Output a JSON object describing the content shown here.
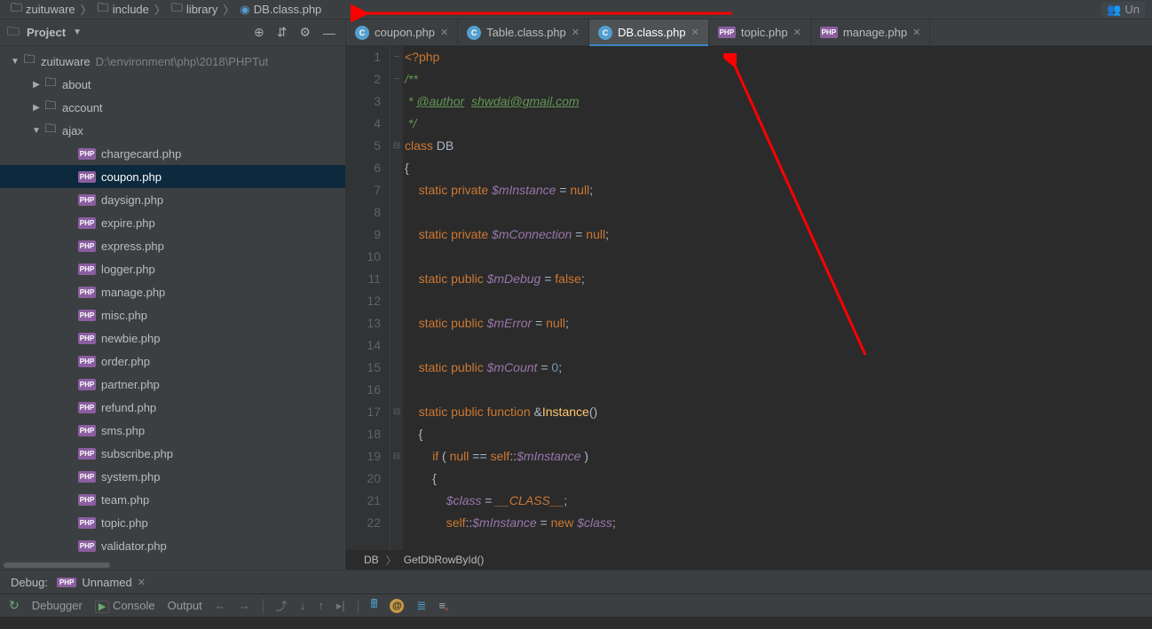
{
  "breadcrumbs": [
    {
      "icon": "folder",
      "label": "zuituware"
    },
    {
      "icon": "folder",
      "label": "include"
    },
    {
      "icon": "folder",
      "label": "library"
    },
    {
      "icon": "php-round",
      "label": "DB.class.php"
    }
  ],
  "top_right_badge": {
    "icon": "mask",
    "label": "Un"
  },
  "project_panel": {
    "title": "Project",
    "tools": [
      "target",
      "collapse",
      "gear",
      "minimize"
    ],
    "tree": [
      {
        "type": "root",
        "depth": 0,
        "arrow": "open",
        "icon": "folder",
        "label": "zuituware",
        "suffix": "D:\\environment\\php\\2018\\PHPTut"
      },
      {
        "type": "dir",
        "depth": 1,
        "arrow": "closed",
        "icon": "folder",
        "label": "about"
      },
      {
        "type": "dir",
        "depth": 1,
        "arrow": "closed",
        "icon": "folder",
        "label": "account"
      },
      {
        "type": "dir",
        "depth": 1,
        "arrow": "open",
        "icon": "folder",
        "label": "ajax"
      },
      {
        "type": "file",
        "depth": 2,
        "arrow": "none",
        "icon": "php",
        "label": "chargecard.php"
      },
      {
        "type": "file",
        "depth": 2,
        "arrow": "none",
        "icon": "php",
        "label": "coupon.php",
        "selected": true
      },
      {
        "type": "file",
        "depth": 2,
        "arrow": "none",
        "icon": "php",
        "label": "daysign.php"
      },
      {
        "type": "file",
        "depth": 2,
        "arrow": "none",
        "icon": "php",
        "label": "expire.php"
      },
      {
        "type": "file",
        "depth": 2,
        "arrow": "none",
        "icon": "php",
        "label": "express.php"
      },
      {
        "type": "file",
        "depth": 2,
        "arrow": "none",
        "icon": "php",
        "label": "logger.php"
      },
      {
        "type": "file",
        "depth": 2,
        "arrow": "none",
        "icon": "php",
        "label": "manage.php"
      },
      {
        "type": "file",
        "depth": 2,
        "arrow": "none",
        "icon": "php",
        "label": "misc.php"
      },
      {
        "type": "file",
        "depth": 2,
        "arrow": "none",
        "icon": "php",
        "label": "newbie.php"
      },
      {
        "type": "file",
        "depth": 2,
        "arrow": "none",
        "icon": "php",
        "label": "order.php"
      },
      {
        "type": "file",
        "depth": 2,
        "arrow": "none",
        "icon": "php",
        "label": "partner.php"
      },
      {
        "type": "file",
        "depth": 2,
        "arrow": "none",
        "icon": "php",
        "label": "refund.php"
      },
      {
        "type": "file",
        "depth": 2,
        "arrow": "none",
        "icon": "php",
        "label": "sms.php"
      },
      {
        "type": "file",
        "depth": 2,
        "arrow": "none",
        "icon": "php",
        "label": "subscribe.php"
      },
      {
        "type": "file",
        "depth": 2,
        "arrow": "none",
        "icon": "php",
        "label": "system.php"
      },
      {
        "type": "file",
        "depth": 2,
        "arrow": "none",
        "icon": "php",
        "label": "team.php"
      },
      {
        "type": "file",
        "depth": 2,
        "arrow": "none",
        "icon": "php",
        "label": "topic.php"
      },
      {
        "type": "file",
        "depth": 2,
        "arrow": "none",
        "icon": "php",
        "label": "validator.php"
      }
    ]
  },
  "tabs": [
    {
      "icon": "php-round",
      "label": "coupon.php",
      "active": false
    },
    {
      "icon": "php-round",
      "label": "Table.class.php",
      "active": false
    },
    {
      "icon": "php-round",
      "label": "DB.class.php",
      "active": true
    },
    {
      "icon": "php-badge",
      "label": "topic.php",
      "active": false
    },
    {
      "icon": "php-badge",
      "label": "manage.php",
      "active": false
    }
  ],
  "editor": {
    "line_numbers": [
      "1",
      "2",
      "3",
      "4",
      "5",
      "6",
      "7",
      "8",
      "9",
      "10",
      "11",
      "12",
      "13",
      "14",
      "15",
      "16",
      "17",
      "18",
      "19",
      "20",
      "21",
      "22"
    ],
    "fold_markers": {
      "1": "−",
      "2": "−",
      "5": "⊟",
      "17": "⊟",
      "19": "⊟"
    },
    "lines_html": [
      "<span class='c-php'>&lt;?php</span>",
      "<span class='c-doc'>/**</span>",
      "<span class='c-doc'> * </span><span class='c-doc-tag'>@author</span><span class='c-doc'>  </span><span class='c-doc-link'>shwdai@gmail.com</span>",
      "<span class='c-doc'> */</span>",
      "<span class='c-kw'>class</span> <span class='c-cls'>DB</span>",
      "<span class='c-op'>{</span>",
      "    <span class='c-kw'>static private</span> <span class='c-var'>$mInstance</span> <span class='c-op'>=</span> <span class='c-kw'>null</span><span class='c-op'>;</span>",
      "",
      "    <span class='c-kw'>static private</span> <span class='c-var'>$mConnection</span> <span class='c-op'>=</span> <span class='c-kw'>null</span><span class='c-op'>;</span>",
      "",
      "    <span class='c-kw'>static public</span> <span class='c-var'>$mDebug</span> <span class='c-op'>=</span> <span class='c-kw'>false</span><span class='c-op'>;</span>",
      "",
      "    <span class='c-kw'>static public</span> <span class='c-var'>$mError</span> <span class='c-op'>=</span> <span class='c-kw'>null</span><span class='c-op'>;</span>",
      "",
      "    <span class='c-kw'>static public</span> <span class='c-var'>$mCount</span> <span class='c-op'>=</span> <span class='c-num'>0</span><span class='c-op'>;</span>",
      "",
      "    <span class='c-kw'>static public function</span> <span class='c-op'>&amp;</span><span class='c-fn'>Instance</span><span class='c-op'>()</span>",
      "    <span class='c-op'>{</span>",
      "        <span class='c-kw'>if</span> <span class='c-op'>(</span> <span class='c-kw'>null</span> <span class='c-op'>==</span> <span class='c-kw'>self</span><span class='c-op'>::</span><span class='c-var'>$mInstance</span> <span class='c-op'>)</span>",
      "        <span class='c-op'>{</span>",
      "            <span class='c-var'>$class</span> <span class='c-op'>=</span> <span class='c-kw c-italic'>__CLASS__</span><span class='c-op'>;</span>",
      "            <span class='c-kw'>self</span><span class='c-op'>::</span><span class='c-var'>$mInstance</span> <span class='c-op'>=</span> <span class='c-kw'>new</span> <span class='c-var'>$class</span><span class='c-op'>;</span>"
    ],
    "bottom_crumb": [
      "DB",
      "GetDbRowById()"
    ]
  },
  "debug_panel": {
    "label": "Debug:",
    "tab": "Unnamed"
  },
  "bottom_bar": {
    "debugger_label": "Debugger",
    "console_label": "Console",
    "output_label": "Output"
  }
}
